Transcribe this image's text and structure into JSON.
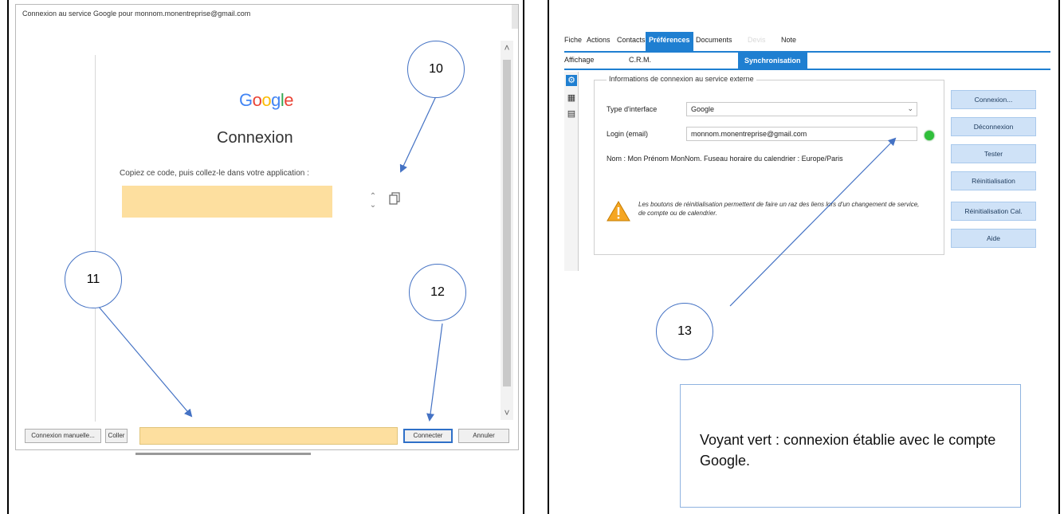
{
  "dialog": {
    "title": "Connexion au service Google pour monnom.monentreprise@gmail.com",
    "logo": "Google",
    "heading": "Connexion",
    "copy_instruction": "Copiez ce code, puis collez-le dans votre application :",
    "code_value": "",
    "paste_value": "",
    "buttons": {
      "manual": "Connexion manuelle...",
      "paste": "Coller",
      "connect": "Connecter",
      "cancel": "Annuler"
    }
  },
  "app": {
    "menu": [
      "Fiche",
      "Actions",
      "Contacts",
      "Préférences",
      "Documents",
      "Devis",
      "Note"
    ],
    "active_menu": "Préférences",
    "subtabs": [
      "Affichage",
      "C.R.M.",
      "Synchronisation"
    ],
    "active_subtab": "Synchronisation",
    "group_title": "Informations de connexion au service externe",
    "interface_label": "Type d'interface",
    "interface_value": "Google",
    "login_label": "Login (email)",
    "login_value": "monnom.monentreprise@gmail.com",
    "status_line": "Nom : Mon Prénom MonNom. Fuseau horaire du calendrier : Europe/Paris",
    "warning_text": "Les boutons de réinitialisation permettent de faire un raz des liens lors d'un changement de service, de compte ou de calendrier.",
    "status_led_color": "#2fbf3a",
    "accent_color": "#1f7fd1",
    "side_buttons": [
      "Connexion...",
      "Déconnexion",
      "Tester",
      "Réinitialisation",
      "Réinitialisation Cal.",
      "Aide"
    ]
  },
  "callouts": {
    "c10": "10",
    "c11": "11",
    "c12": "12",
    "c13": "13"
  },
  "note": {
    "text": "Voyant vert : connexion établie avec le compte Google."
  }
}
